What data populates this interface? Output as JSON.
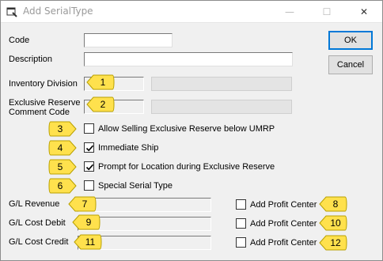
{
  "window": {
    "title": "Add SerialType",
    "minimize": "—",
    "maximize": "☐",
    "close": "✕"
  },
  "buttons": {
    "ok": "OK",
    "cancel": "Cancel"
  },
  "fields": {
    "code": "Code",
    "description": "Description",
    "inventory_division": "Inventory Division",
    "exclusive_reserve_line1": "Exclusive Reserve",
    "exclusive_reserve_line2": "Comment Code",
    "gl_revenue": "G/L Revenue",
    "gl_cost_debit": "G/L Cost Debit",
    "gl_cost_credit": "G/L Cost Credit"
  },
  "checkboxes": {
    "allow_selling": {
      "label": "Allow Selling Exclusive Reserve below UMRP",
      "checked": false
    },
    "immediate_ship": {
      "label": "Immediate Ship",
      "checked": true
    },
    "prompt_location": {
      "label": "Prompt for Location during Exclusive Reserve",
      "checked": true
    },
    "special_serial": {
      "label": "Special Serial Type",
      "checked": false
    },
    "profit_center_revenue": {
      "label": "Add Profit Center",
      "checked": false
    },
    "profit_center_debit": {
      "label": "Add Profit Center",
      "checked": false
    },
    "profit_center_credit": {
      "label": "Add Profit Center",
      "checked": false
    }
  },
  "callouts": [
    "1",
    "2",
    "3",
    "4",
    "5",
    "6",
    "7",
    "8",
    "9",
    "10",
    "11",
    "12"
  ],
  "colors": {
    "callout_fill": "#ffe14d",
    "callout_stroke": "#b8a000",
    "accent": "#0078d7"
  }
}
